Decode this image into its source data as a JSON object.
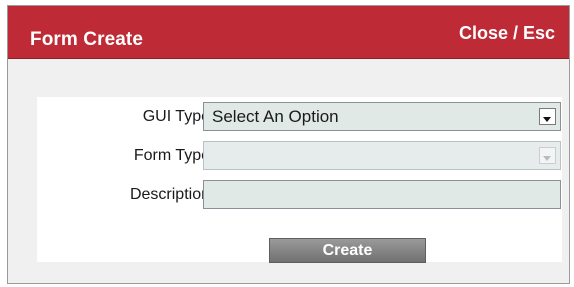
{
  "dialog": {
    "title": "Form Create",
    "close_label": "Close / Esc"
  },
  "form": {
    "gui_type": {
      "label": "GUI Type",
      "value": "Select An Option"
    },
    "form_type": {
      "label": "Form Type",
      "value": ""
    },
    "description": {
      "label": "Description",
      "value": ""
    },
    "create_label": "Create"
  },
  "colors": {
    "titlebar": "#be2b36",
    "field_bg": "#e1e9e6",
    "button": "#7f7f7f"
  }
}
